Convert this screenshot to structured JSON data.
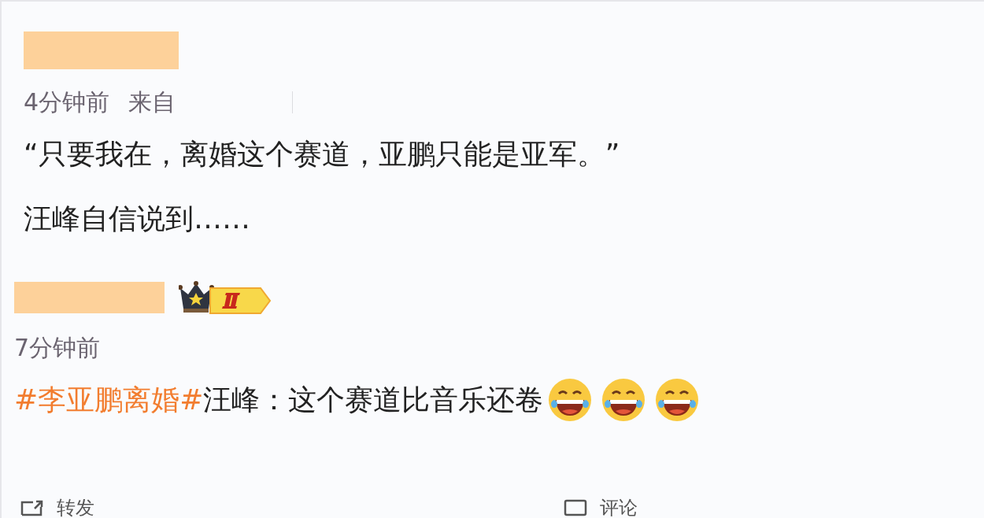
{
  "posts": [
    {
      "time": "4分钟前",
      "source": "来自",
      "badge": false,
      "paragraphs": [
        [
          {
            "kind": "plain",
            "text": "“只要我在，离婚这个赛道，亚鹏只能是亚军。”"
          }
        ],
        [
          {
            "kind": "plain",
            "text": "汪峰自信说到……"
          }
        ]
      ]
    },
    {
      "time": "7分钟前",
      "badge": true,
      "paragraphs": [
        [
          {
            "kind": "hashtag",
            "text": "#李亚鹏离婚#"
          },
          {
            "kind": "plain",
            "text": "汪峰：这个赛道比音乐还卷"
          },
          {
            "kind": "emoji"
          },
          {
            "kind": "emoji"
          },
          {
            "kind": "emoji"
          }
        ]
      ]
    }
  ],
  "actions": [
    {
      "kind": "repost",
      "label": "转发"
    },
    {
      "kind": "comment",
      "label": "评论"
    }
  ]
}
